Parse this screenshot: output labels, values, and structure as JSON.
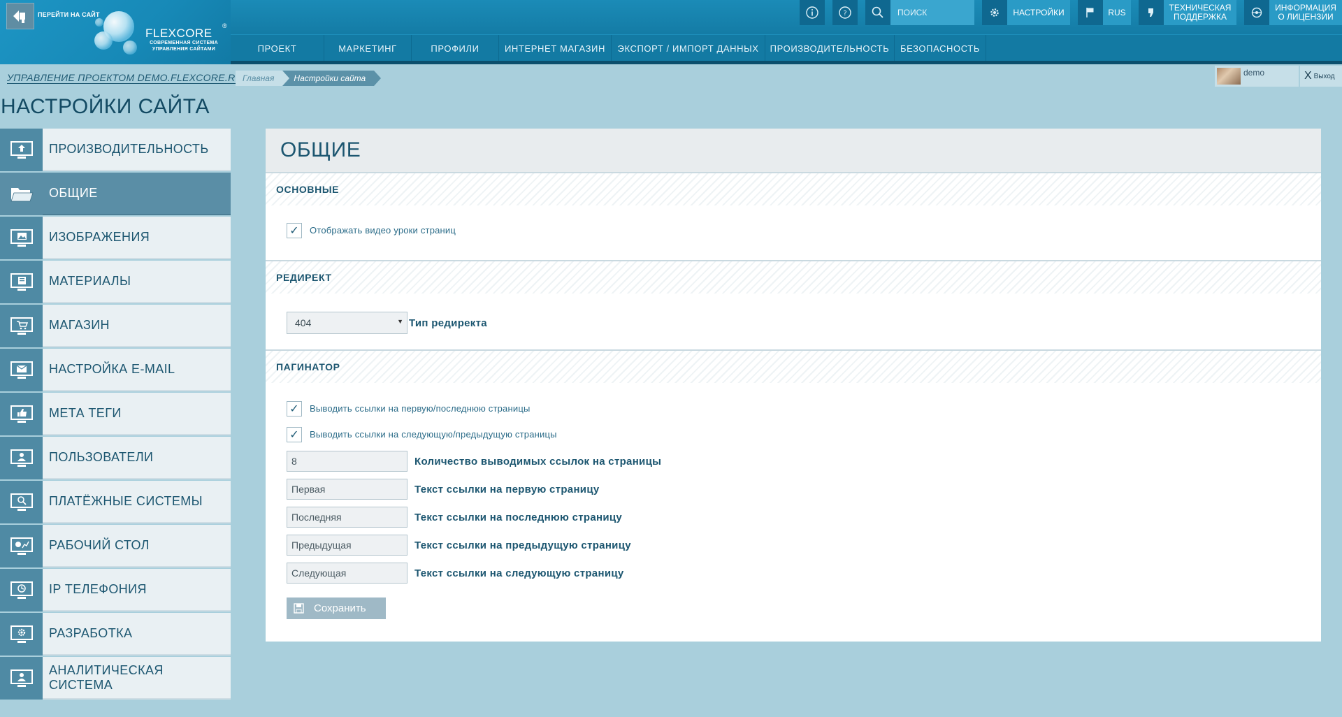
{
  "header": {
    "go_to_site": "ПЕРЕЙТИ НА САЙТ",
    "logo_name": "FLEXCORE",
    "logo_reg": "®",
    "logo_tagline_1": "СОВРЕМЕННАЯ СИСТЕМА",
    "logo_tagline_2": "УПРАВЛЕНИЯ САЙТАМИ",
    "search_placeholder": "ПОИСК",
    "settings_label": "НАСТРОЙКИ",
    "language_label": "RUS",
    "support_label_1": "ТЕХНИЧЕСКАЯ",
    "support_label_2": "ПОДДЕРЖКА",
    "license_label_1": "ИНФОРМАЦИЯ",
    "license_label_2": "О ЛИЦЕНЗИИ",
    "icons": [
      "info-icon",
      "help-icon",
      "search-icon",
      "gear-icon",
      "flag-icon",
      "support-icon",
      "license-icon"
    ]
  },
  "nav": {
    "items": [
      {
        "label": "ПРОЕКТ"
      },
      {
        "label": "МАРКЕТИНГ"
      },
      {
        "label": "ПРОФИЛИ"
      },
      {
        "label": "ИНТЕРНЕТ МАГАЗИН"
      },
      {
        "label": "ЭКСПОРТ / ИМПОРТ ДАННЫХ"
      },
      {
        "label": "ПРОИЗВОДИТЕЛЬНОСТЬ"
      },
      {
        "label": "БЕЗОПАСНОСТЬ"
      }
    ]
  },
  "subheader": {
    "project_link": "УПРАВЛЕНИЕ ПРОЕКТОМ DEMO.FLEXCORE.RU",
    "breadcrumb_home": "Главная",
    "breadcrumb_current": "Настройки сайта",
    "user_name": "demo",
    "logout_x": "X",
    "logout_label": "Выход"
  },
  "page_title": "НАСТРОЙКИ САЙТА",
  "sidebar": {
    "items": [
      {
        "label": "ПРОИЗВОДИТЕЛЬНОСТЬ",
        "icon": "upload-monitor-icon",
        "active": false
      },
      {
        "label": "ОБЩИЕ",
        "icon": "folder-icon",
        "active": true
      },
      {
        "label": "ИЗОБРАЖЕНИЯ",
        "icon": "image-monitor-icon",
        "active": false
      },
      {
        "label": "МАТЕРИАЛЫ",
        "icon": "materials-monitor-icon",
        "active": false
      },
      {
        "label": "МАГАЗИН",
        "icon": "cart-monitor-icon",
        "active": false
      },
      {
        "label": "НАСТРОЙКА E-MAIL",
        "icon": "mail-monitor-icon",
        "active": false
      },
      {
        "label": "МЕТА ТЕГИ",
        "icon": "thumbs-up-monitor-icon",
        "active": false
      },
      {
        "label": "ПОЛЬЗОВАТЕЛИ",
        "icon": "user-monitor-icon",
        "active": false
      },
      {
        "label": "ПЛАТЁЖНЫЕ СИСТЕМЫ",
        "icon": "search-monitor-icon",
        "active": false
      },
      {
        "label": "РАБОЧИЙ СТОЛ",
        "icon": "chart-monitor-icon",
        "active": false
      },
      {
        "label": "IP ТЕЛЕФОНИЯ",
        "icon": "clock-monitor-icon",
        "active": false
      },
      {
        "label": "РАЗРАБОТКА",
        "icon": "gear-monitor-icon",
        "active": false
      },
      {
        "label": "АНАЛИТИЧЕСКАЯ СИСТЕМА",
        "icon": "user-monitor-icon",
        "active": false
      }
    ]
  },
  "panel": {
    "title": "ОБЩИЕ",
    "sections": {
      "basic": {
        "title": "ОСНОВНЫЕ",
        "show_video_label": "Отображать видео уроки страниц",
        "show_video_checked": true
      },
      "redirect": {
        "title": "РЕДИРЕКТ",
        "select_value": "404",
        "select_label": "Тип редиректа"
      },
      "paginator": {
        "title": "ПАГИНАТОР",
        "first_last_label": "Выводить ссылки на первую/последнюю страницы",
        "first_last_checked": true,
        "next_prev_label": "Выводить ссылки на следующую/предыдущую страницы",
        "next_prev_checked": true,
        "fields": [
          {
            "value": "8",
            "label": "Количество выводимых ссылок на страницы"
          },
          {
            "value": "Первая",
            "label": "Текст ссылки на первую страницу"
          },
          {
            "value": "Последняя",
            "label": "Текст ссылки на последнюю страницу"
          },
          {
            "value": "Предыдущая",
            "label": "Текст ссылки на предыдущую страницу"
          },
          {
            "value": "Следующая",
            "label": "Текст ссылки на следующую страницу"
          }
        ]
      }
    },
    "save_label": "Сохранить",
    "checkmark": "✓"
  }
}
